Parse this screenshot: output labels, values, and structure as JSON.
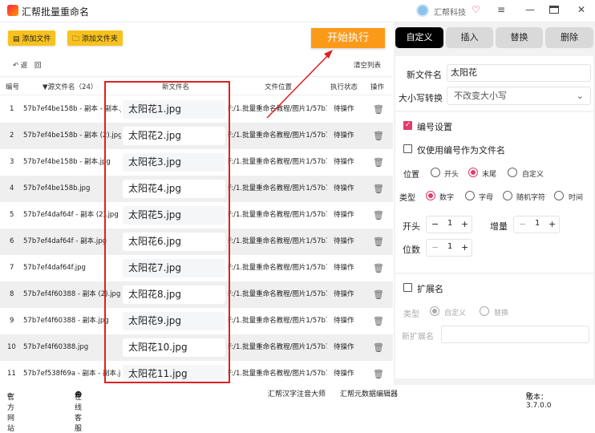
{
  "app": {
    "title": "汇帮批量重命名",
    "company": "汇帮科技"
  },
  "toolbar": {
    "add_file": "添加文件",
    "add_folder": "添加文件夹",
    "start": "开始执行",
    "undo": "返　回",
    "clear": "清空列表"
  },
  "table": {
    "headers": {
      "num": "编号",
      "source": "▼源文件名（24）",
      "newname": "新文件名",
      "location": "文件位置",
      "status": "执行状态",
      "op": "操作"
    },
    "rows": [
      {
        "num": "1",
        "source": "57b7ef4be158b - 副本 - 副本.jpg",
        "newname": "太阳花1.jpg",
        "location": "F:/1.批量重命名教程/图片1/57b7e",
        "status": "待操作"
      },
      {
        "num": "2",
        "source": "57b7ef4be158b - 副本 (2).jpg",
        "newname": "太阳花2.jpg",
        "location": "F:/1.批量重命名教程/图片1/57b7e",
        "status": "待操作"
      },
      {
        "num": "3",
        "source": "57b7ef4be158b - 副本.jpg",
        "newname": "太阳花3.jpg",
        "location": "F:/1.批量重命名教程/图片1/57b7e",
        "status": "待操作"
      },
      {
        "num": "4",
        "source": "57b7ef4be158b.jpg",
        "newname": "太阳花4.jpg",
        "location": "F:/1.批量重命名教程/图片1/57b7e",
        "status": "待操作"
      },
      {
        "num": "5",
        "source": "57b7ef4daf64f - 副本 (2).jpg",
        "newname": "太阳花5.jpg",
        "location": "F:/1.批量重命名教程/图片1/57b7e",
        "status": "待操作"
      },
      {
        "num": "6",
        "source": "57b7ef4daf64f - 副本.jpg",
        "newname": "太阳花6.jpg",
        "location": "F:/1.批量重命名教程/图片1/57b7e",
        "status": "待操作"
      },
      {
        "num": "7",
        "source": "57b7ef4daf64f.jpg",
        "newname": "太阳花7.jpg",
        "location": "F:/1.批量重命名教程/图片1/57b7e",
        "status": "待操作"
      },
      {
        "num": "8",
        "source": "57b7ef4f60388 - 副本 (2).jpg",
        "newname": "太阳花8.jpg",
        "location": "F:/1.批量重命名教程/图片1/57b7e",
        "status": "待操作"
      },
      {
        "num": "9",
        "source": "57b7ef4f60388 - 副本.jpg",
        "newname": "太阳花9.jpg",
        "location": "F:/1.批量重命名教程/图片1/57b7e",
        "status": "待操作"
      },
      {
        "num": "10",
        "source": "57b7ef4f60388.jpg",
        "newname": "太阳花10.jpg",
        "location": "F:/1.批量重命名教程/图片1/57b7e",
        "status": "待操作"
      },
      {
        "num": "11",
        "source": "57b7ef538f69a - 副本 - 副本.jpg",
        "newname": "太阳花11.jpg",
        "location": "F:/1.批量重命名教程/图片1/57b7e",
        "status": "待操作"
      }
    ]
  },
  "tabs": [
    "自定义",
    "插入",
    "替换",
    "删除"
  ],
  "custom": {
    "newname_label": "新文件名",
    "newname_value": "太阳花",
    "case_label": "大小写转换",
    "case_value": "不改变大小写",
    "numbering_label": "编号设置",
    "numbering_checked": true,
    "only_number_label": "仅使用编号作为文件名",
    "only_number_checked": false,
    "position_label": "位置",
    "position_options": [
      "开头",
      "末尾",
      "自定义"
    ],
    "position_selected": "末尾",
    "type_label": "类型",
    "type_options": [
      "数字",
      "字母",
      "随机字符",
      "时间"
    ],
    "type_selected": "数字",
    "start_label": "开头",
    "start_value": "1",
    "increment_label": "增量",
    "increment_value": "1",
    "digits_label": "位数",
    "digits_value": "1",
    "ext_label": "扩展名",
    "ext_checked": false,
    "ext_type_label": "类型",
    "ext_type_options": [
      "自定义",
      "替换"
    ],
    "ext_type_selected": "自定义",
    "new_ext_label": "新扩展名",
    "new_ext_value": ""
  },
  "statusbar": {
    "website": "官方网站",
    "support": "在线客服",
    "link1": "汇帮汉字注音大师",
    "link2": "汇帮元数据编辑器",
    "version": "版本：3.7.0.0"
  },
  "colors": {
    "accent": "#e23a6b",
    "start_button": "#fb9a19",
    "toolbar_button": "#f8c21e",
    "highlight_box": "#e02020"
  }
}
